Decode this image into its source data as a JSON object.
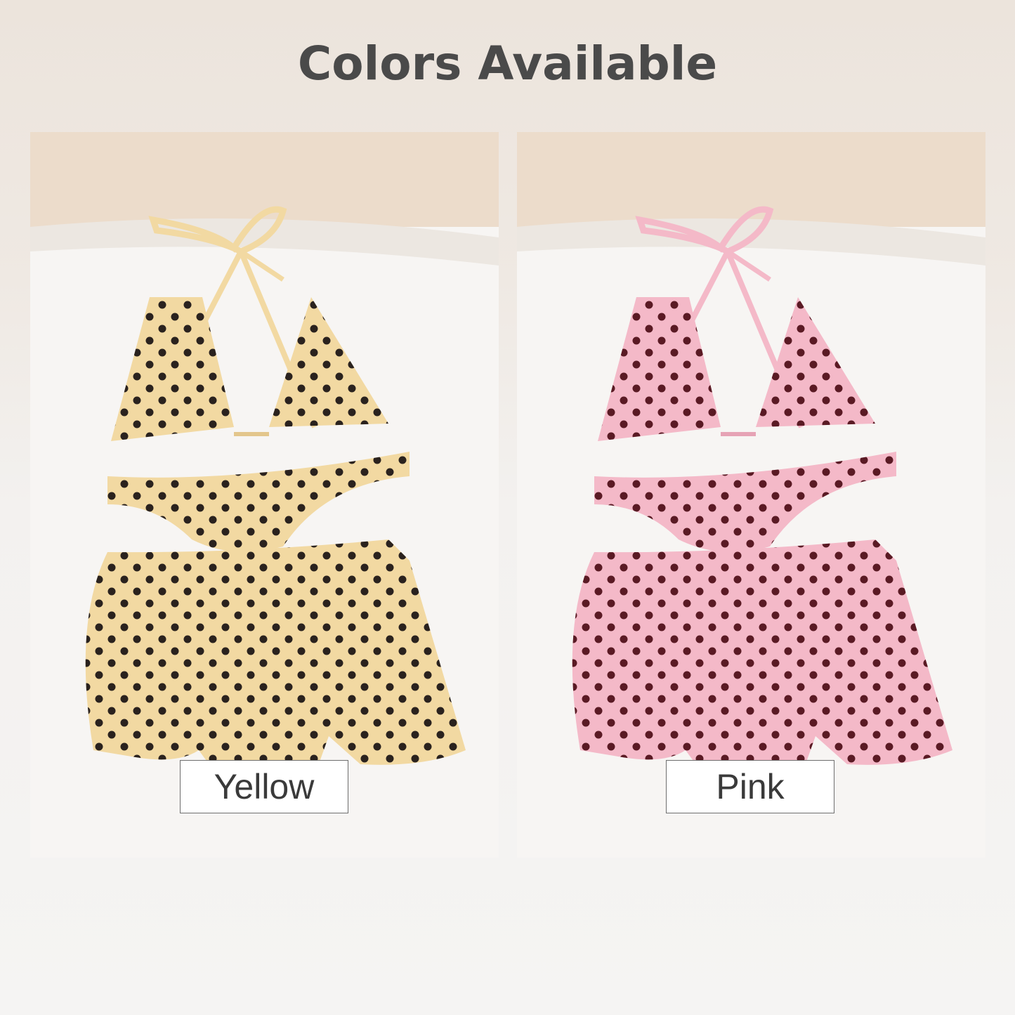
{
  "header": {
    "title": "Colors Available"
  },
  "variants": [
    {
      "label": "Yellow",
      "fabric": "#f2d9a2",
      "fabric_shade": "#e3c68c",
      "dot": "#2a221e"
    },
    {
      "label": "Pink",
      "fabric": "#f4b9c8",
      "fabric_shade": "#e6a3b5",
      "dot": "#5a1a24"
    }
  ],
  "scene": {
    "sand": "#f7f5f3",
    "sand_shadow": "#e8e3dd",
    "backdrop": "#ecdccb"
  }
}
